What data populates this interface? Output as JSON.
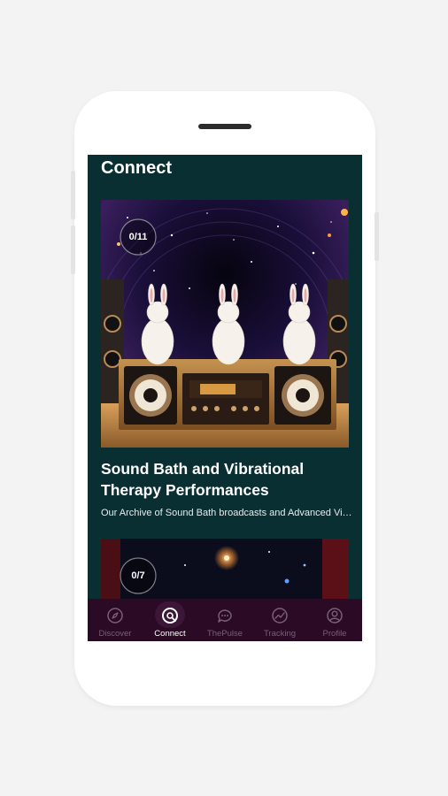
{
  "header": {
    "title": "Connect"
  },
  "cards": [
    {
      "title": "Sound Bath and Vibrational Therapy Performances",
      "description": "Our Archive of Sound Bath broadcasts and Advanced Vibrational Therapy sessions",
      "progress": "0/11"
    },
    {
      "progress": "0/7"
    }
  ],
  "nav": {
    "items": [
      {
        "label": "Discover",
        "icon": "compass-icon",
        "active": false
      },
      {
        "label": "Connect",
        "icon": "connect-icon",
        "active": true
      },
      {
        "label": "ThePulse",
        "icon": "chat-bubble-icon",
        "active": false
      },
      {
        "label": "Tracking",
        "icon": "trend-chart-icon",
        "active": false
      },
      {
        "label": "Profile",
        "icon": "user-circle-icon",
        "active": false
      }
    ]
  },
  "colors": {
    "screen_bg": "#0a2f33",
    "nav_bg": "#2a0a25",
    "nav_inactive": "#7a5f7b",
    "nav_active": "#ffffff"
  }
}
